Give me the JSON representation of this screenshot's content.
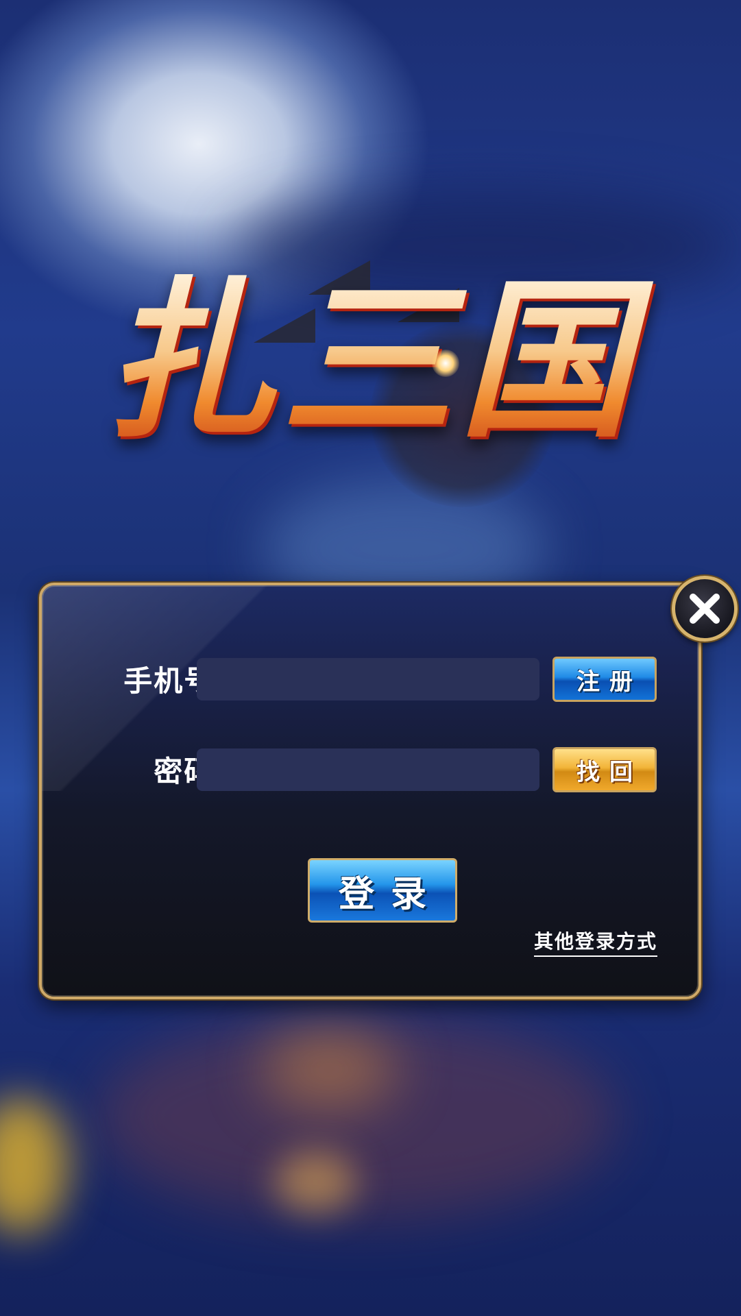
{
  "logo": {
    "title": "扎三国"
  },
  "login_form": {
    "phone_label": "手机号:",
    "phone_value": "",
    "password_label": "密码:",
    "password_value": "",
    "register_label": "注册",
    "retrieve_label": "找回",
    "login_label": "登录",
    "other_login_label": "其他登录方式"
  },
  "icons": {
    "close": "close-icon"
  },
  "colors": {
    "panel_border": "#cfa968",
    "input_bg": "#2a3158",
    "register_button": "#1f8ae6",
    "retrieve_button": "#f2b438",
    "login_button": "#2496ea"
  }
}
